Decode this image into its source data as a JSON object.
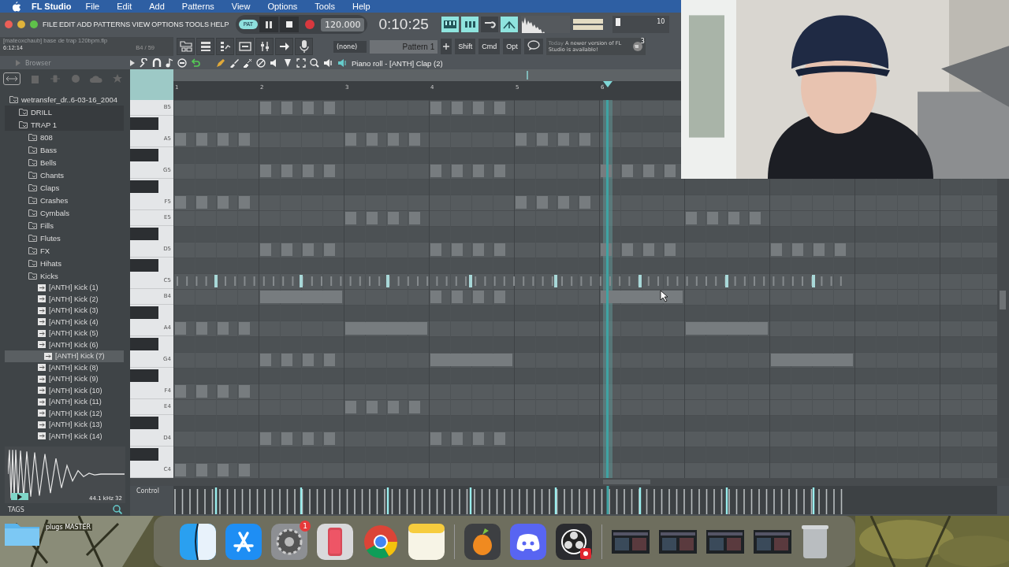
{
  "menu_bar": {
    "app_name": "FL Studio",
    "items": [
      "File",
      "Edit",
      "Add",
      "Patterns",
      "View",
      "Options",
      "Tools",
      "Help"
    ]
  },
  "fl_menu": [
    "FILE",
    "EDIT",
    "ADD",
    "PATTERNS",
    "VIEW",
    "OPTIONS",
    "TOOLS",
    "HELP"
  ],
  "transport": {
    "mode": "PAT",
    "tempo": "120.000",
    "time": "0:10:25"
  },
  "master_pitch": {
    "reading": "10",
    "level": 0.05
  },
  "project": {
    "file": "[mateoxchaub] base de trap 120bpm.flp",
    "time": "6:12:14",
    "position": "B4 / 59"
  },
  "pattern": {
    "channel": "(none)",
    "name": "Pattern 1"
  },
  "modifier_keys": [
    "Shift",
    "Cmd",
    "Opt"
  ],
  "hint": {
    "prefix": "Today",
    "text": "A newer version of FL Studio is available!",
    "count": "3"
  },
  "browser": {
    "title": "Browser",
    "tree": [
      {
        "label": "wetransfer_dr..6-03-16_2004",
        "kind": "folder",
        "selected": false,
        "children": [
          {
            "label": "DRILL",
            "kind": "folder",
            "selected": false
          },
          {
            "label": "TRAP 1",
            "kind": "folder",
            "selected": false,
            "children": [
              {
                "label": "808",
                "kind": "folder",
                "selected": false
              },
              {
                "label": "Bass",
                "kind": "folder",
                "selected": false
              },
              {
                "label": "Bells",
                "kind": "folder",
                "selected": false
              },
              {
                "label": "Chants",
                "kind": "folder",
                "selected": false
              },
              {
                "label": "Claps",
                "kind": "folder",
                "selected": false
              },
              {
                "label": "Crashes",
                "kind": "folder",
                "selected": false
              },
              {
                "label": "Cymbals",
                "kind": "folder",
                "selected": false
              },
              {
                "label": "Fills",
                "kind": "folder",
                "selected": false
              },
              {
                "label": "Flutes",
                "kind": "folder",
                "selected": false
              },
              {
                "label": "FX",
                "kind": "folder",
                "selected": false
              },
              {
                "label": "Hihats",
                "kind": "folder",
                "selected": false
              },
              {
                "label": "Kicks",
                "kind": "folder",
                "selected": false,
                "children": [
                  {
                    "label": "[ANTH] Kick (1)",
                    "kind": "sample",
                    "selected": false
                  },
                  {
                    "label": "[ANTH] Kick (2)",
                    "kind": "sample",
                    "selected": false
                  },
                  {
                    "label": "[ANTH] Kick (3)",
                    "kind": "sample",
                    "selected": false
                  },
                  {
                    "label": "[ANTH] Kick (4)",
                    "kind": "sample",
                    "selected": false
                  },
                  {
                    "label": "[ANTH] Kick (5)",
                    "kind": "sample",
                    "selected": false
                  },
                  {
                    "label": "[ANTH] Kick (6)",
                    "kind": "sample",
                    "selected": false
                  },
                  {
                    "label": "[ANTH] Kick (7)",
                    "kind": "sample",
                    "selected": true
                  },
                  {
                    "label": "[ANTH] Kick (8)",
                    "kind": "sample",
                    "selected": false
                  },
                  {
                    "label": "[ANTH] Kick (9)",
                    "kind": "sample",
                    "selected": false
                  },
                  {
                    "label": "[ANTH] Kick (10)",
                    "kind": "sample",
                    "selected": false
                  },
                  {
                    "label": "[ANTH] Kick (11)",
                    "kind": "sample",
                    "selected": false
                  },
                  {
                    "label": "[ANTH] Kick (12)",
                    "kind": "sample",
                    "selected": false
                  },
                  {
                    "label": "[ANTH] Kick (13)",
                    "kind": "sample",
                    "selected": false
                  },
                  {
                    "label": "[ANTH] Kick (14)",
                    "kind": "sample",
                    "selected": false
                  }
                ]
              }
            ]
          }
        ]
      }
    ],
    "sample_info": "44.1 kHz 32",
    "tags_label": "TAGS"
  },
  "piano_roll": {
    "title": "Piano roll - [ANTH] Clap (2)",
    "bars": [
      "1",
      "2",
      "3",
      "4",
      "5",
      "6"
    ],
    "control_label": "Control",
    "keys": [
      {
        "label": "B5",
        "black": false
      },
      {
        "black": true
      },
      {
        "label": "A5",
        "black": false
      },
      {
        "black": true
      },
      {
        "label": "G5",
        "black": false
      },
      {
        "black": true
      },
      {
        "label": "F5",
        "black": false
      },
      {
        "label": "E5",
        "black": false
      },
      {
        "black": true
      },
      {
        "label": "D5",
        "black": false
      },
      {
        "black": true
      },
      {
        "label": "C5",
        "black": false
      },
      {
        "label": "B4",
        "black": false
      },
      {
        "black": true
      },
      {
        "label": "A4",
        "black": false
      },
      {
        "black": true
      },
      {
        "label": "G4",
        "black": false
      },
      {
        "black": true
      },
      {
        "label": "F4",
        "black": false
      },
      {
        "label": "E4",
        "black": false
      },
      {
        "black": true
      },
      {
        "label": "D4",
        "black": false
      },
      {
        "black": true
      },
      {
        "label": "C4",
        "black": false
      }
    ]
  },
  "desktop": {
    "folder": "plugs MASTER"
  },
  "dock": [
    {
      "kind": "finder"
    },
    {
      "kind": "app-store"
    },
    {
      "kind": "settings",
      "badge": "1"
    },
    {
      "kind": "phone"
    },
    {
      "kind": "chrome"
    },
    {
      "kind": "notes"
    },
    {
      "kind": "separator"
    },
    {
      "kind": "fruit"
    },
    {
      "kind": "discord"
    },
    {
      "kind": "obs"
    },
    {
      "kind": "separator"
    },
    {
      "kind": "window"
    },
    {
      "kind": "window"
    },
    {
      "kind": "window"
    },
    {
      "kind": "window"
    },
    {
      "kind": "trash"
    }
  ]
}
